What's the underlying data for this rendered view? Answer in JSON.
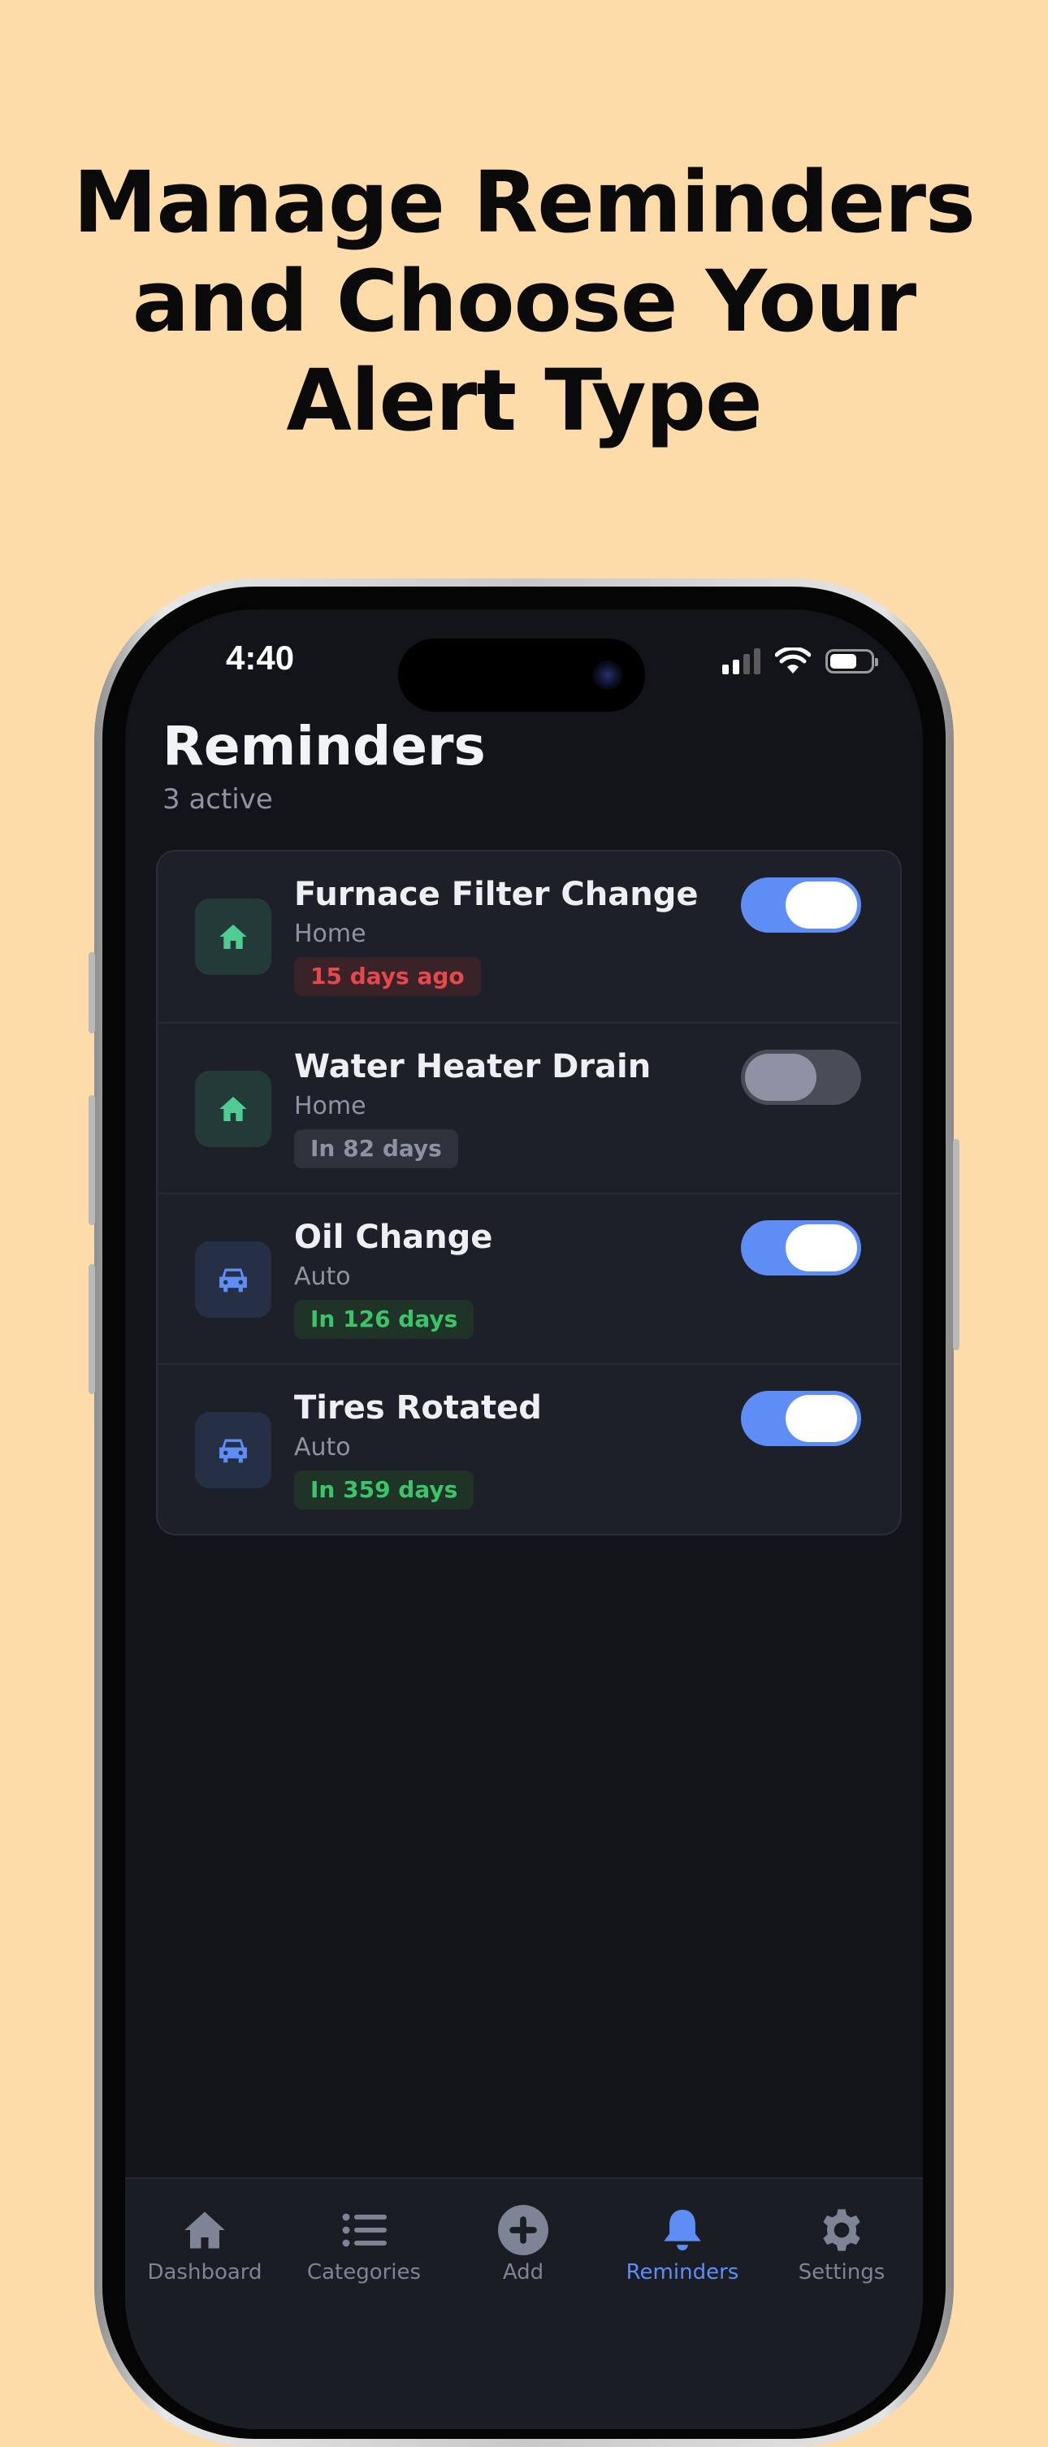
{
  "headline": [
    "Manage Reminders",
    "and Choose Your",
    "Alert Type"
  ],
  "status_bar": {
    "time": "4:40"
  },
  "screen": {
    "title": "Reminders",
    "subtitle": "3 active"
  },
  "reminders": [
    {
      "title": "Furnace Filter Change",
      "category": "Home",
      "icon": "house-icon",
      "due": "15 days ago",
      "due_status": "overdue",
      "enabled": true
    },
    {
      "title": "Water Heater Drain",
      "category": "Home",
      "icon": "house-icon",
      "due": "In 82 days",
      "due_status": "upcoming",
      "enabled": false
    },
    {
      "title": "Oil Change",
      "category": "Auto",
      "icon": "car-icon",
      "due": "In 126 days",
      "due_status": "ok",
      "enabled": true
    },
    {
      "title": "Tires Rotated",
      "category": "Auto",
      "icon": "car-icon",
      "due": "In 359 days",
      "due_status": "ok",
      "enabled": true
    }
  ],
  "tabs": [
    {
      "label": "Dashboard",
      "icon": "house-icon",
      "active": false
    },
    {
      "label": "Categories",
      "icon": "list-icon",
      "active": false
    },
    {
      "label": "Add",
      "icon": "plus-circle-icon",
      "active": false
    },
    {
      "label": "Reminders",
      "icon": "bell-icon",
      "active": true
    },
    {
      "label": "Settings",
      "icon": "gear-icon",
      "active": false
    }
  ],
  "colors": {
    "background": "#FDDCA9",
    "accent": "#5E8EF5",
    "overdue": "#E5484D",
    "ok": "#3CC46A",
    "home_icon": "#4FCB94",
    "auto_icon": "#5E8EF5"
  }
}
